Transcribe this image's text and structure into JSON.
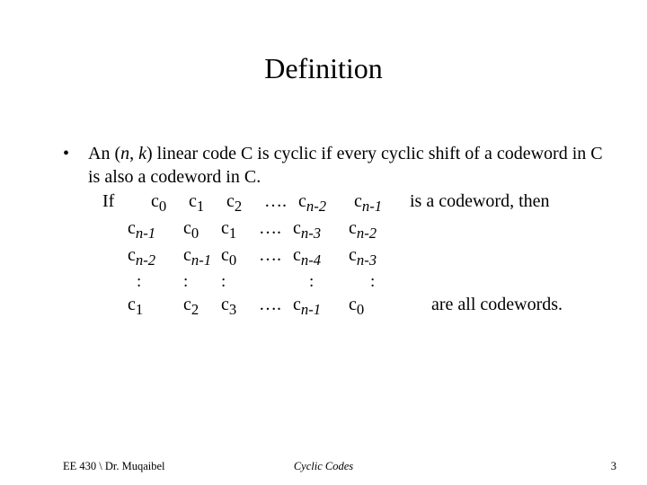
{
  "title": "Definition",
  "bullet_mark": "•",
  "definition_line": "An (n, k) linear code C is cyclic if every cyclic shift of a codeword in C is also a codeword in C.",
  "if_prefix": "If",
  "codeword_suffix": "is a codeword, then",
  "allcw_suffix": "are  all codewords.",
  "c": {
    "c0": "c",
    "c0_sub": "0",
    "c1": "c",
    "c1_sub": "1",
    "c2": "c",
    "c2_sub": "2",
    "c3": "c",
    "c3_sub": "3",
    "cn1": "c",
    "cn1_sub": "n-1",
    "cn2": "c",
    "cn2_sub": "n-2",
    "cn3": "c",
    "cn3_sub": "n-3",
    "cn4": "c",
    "cn4_sub": "n-4"
  },
  "dots": "….",
  "colon": ":",
  "footer": {
    "left": "EE 430 \\ Dr. Muqaibel",
    "center": "Cyclic Codes",
    "right": "3"
  }
}
